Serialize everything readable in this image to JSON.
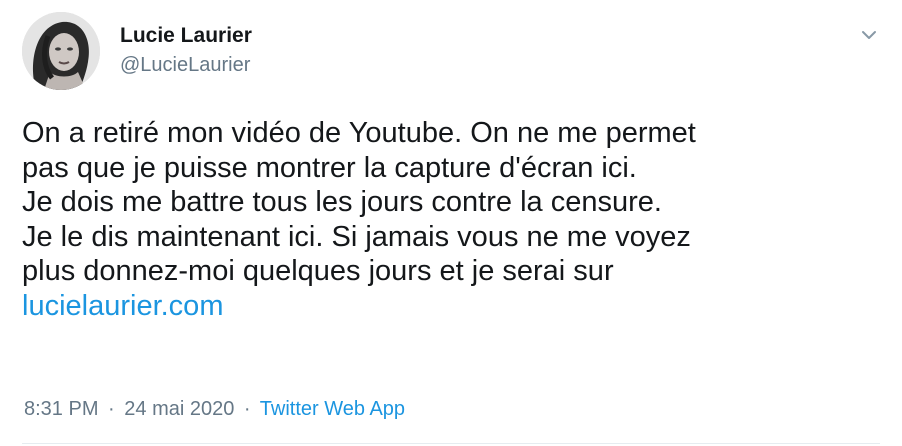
{
  "author": {
    "name": "Lucie Laurier",
    "handle": "@LucieLaurier"
  },
  "tweet": {
    "text": "On a retiré mon vidéo de Youtube. On ne me permet\npas que je puisse montrer la capture d'écran ici.\nJe dois me battre tous les jours contre la censure.\nJe le dis maintenant ici. Si jamais vous ne me voyez\nplus donnez-moi quelques jours et je serai sur\n",
    "link": "lucielaurier.com"
  },
  "meta": {
    "time": "8:31 PM",
    "separator": "·",
    "date": "24 mai 2020",
    "source": "Twitter Web App"
  },
  "icons": {
    "menu": "chevron-down-icon",
    "avatar": "profile-photo"
  },
  "colors": {
    "text": "#14171a",
    "secondary": "#657786",
    "link": "#1b95e0",
    "border": "#e6ecf0"
  }
}
